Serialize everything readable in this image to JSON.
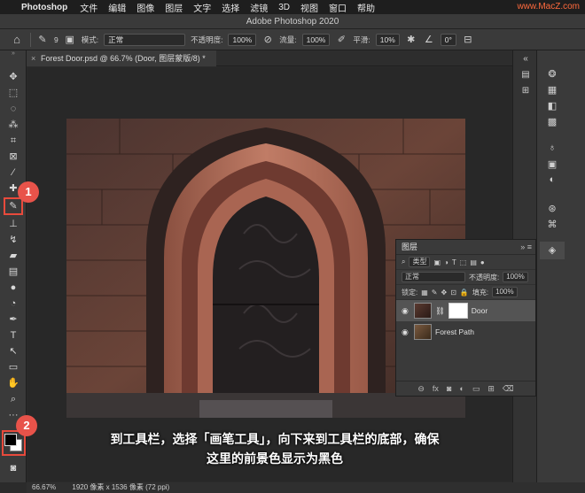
{
  "menubar": {
    "app": "Photoshop",
    "items": [
      "文件",
      "编辑",
      "图像",
      "图层",
      "文字",
      "选择",
      "滤镜",
      "3D",
      "视图",
      "窗口",
      "帮助"
    ],
    "watermark": "www.MacZ.com"
  },
  "window": {
    "title": "Adobe Photoshop 2020"
  },
  "options": {
    "mode_label": "模式:",
    "mode_value": "正常",
    "opacity_label": "不透明度:",
    "opacity_value": "100%",
    "flow_label": "流量:",
    "flow_value": "100%",
    "smooth_label": "平滑:",
    "smooth_value": "10%",
    "angle_value": "0°",
    "brush_size": "9"
  },
  "document": {
    "tab_title": "Forest Door.psd @ 66.7% (Door, 图层蒙版/8) *"
  },
  "badges": [
    "1",
    "2"
  ],
  "layers_panel": {
    "title": "图层",
    "filter_label": "类型",
    "blend_mode": "正常",
    "opacity_label": "不透明度:",
    "opacity_value": "100%",
    "lock_label": "锁定:",
    "fill_label": "填充:",
    "fill_value": "100%",
    "layers": [
      {
        "name": "Door",
        "selected": true
      },
      {
        "name": "Forest Path",
        "selected": false
      }
    ]
  },
  "caption": {
    "line1": "到工具栏，选择「画笔工具」，向下来到工具栏的底部，确保",
    "line2": "这里的前景色显示为黑色"
  },
  "status": {
    "zoom": "66.67%",
    "size": "1920 像素 x 1536 像素 (72 ppi)"
  },
  "colors": {
    "highlight": "#e84a3c",
    "badge": "#e8534a",
    "foreground": "#000000",
    "background": "#ffffff"
  }
}
